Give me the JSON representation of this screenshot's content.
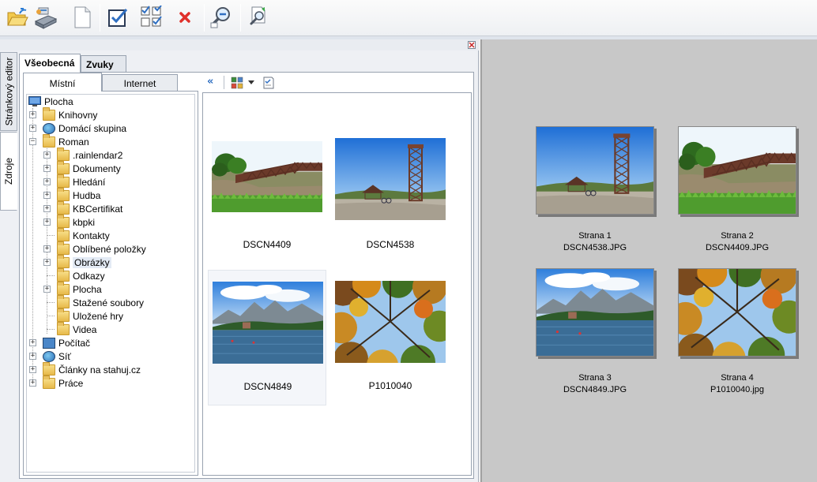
{
  "toolbar": {
    "buttons": [
      {
        "icon": "open-folder-icon"
      },
      {
        "icon": "scanner-icon"
      },
      {
        "icon": "blank-page-icon"
      },
      {
        "icon": "check-all-icon"
      },
      {
        "icon": "select-grid-icon"
      },
      {
        "icon": "delete-icon"
      },
      {
        "icon": "zoom-out-icon"
      },
      {
        "icon": "print-preview-icon"
      }
    ]
  },
  "side_tabs": [
    "Stránkový editor",
    "Zdroje"
  ],
  "main_tabs": [
    "Všeobecná",
    "Zvuky"
  ],
  "sub_tabs": [
    "Místní",
    "Internet"
  ],
  "tree": {
    "root": "Plocha",
    "items": [
      {
        "label": "Knihovny",
        "level": 1,
        "expander": "+"
      },
      {
        "label": "Domácí skupina",
        "level": 1,
        "expander": "+"
      },
      {
        "label": "Roman",
        "level": 1,
        "expander": "−"
      },
      {
        "label": ".rainlendar2",
        "level": 2,
        "expander": "+"
      },
      {
        "label": "Dokumenty",
        "level": 2,
        "expander": "+"
      },
      {
        "label": "Hledání",
        "level": 2,
        "expander": "+"
      },
      {
        "label": "Hudba",
        "level": 2,
        "expander": "+"
      },
      {
        "label": "KBCertifikat",
        "level": 2,
        "expander": "+"
      },
      {
        "label": "kbpki",
        "level": 2,
        "expander": "+"
      },
      {
        "label": "Kontakty",
        "level": 2,
        "expander": ""
      },
      {
        "label": "Oblíbené položky",
        "level": 2,
        "expander": "+"
      },
      {
        "label": "Obrázky",
        "level": 2,
        "expander": "+",
        "selected": true
      },
      {
        "label": "Odkazy",
        "level": 2,
        "expander": ""
      },
      {
        "label": "Plocha",
        "level": 2,
        "expander": "+"
      },
      {
        "label": "Stažené soubory",
        "level": 2,
        "expander": ""
      },
      {
        "label": "Uložené hry",
        "level": 2,
        "expander": ""
      },
      {
        "label": "Videa",
        "level": 2,
        "expander": ""
      },
      {
        "label": "Počítač",
        "level": 1,
        "expander": "+"
      },
      {
        "label": "Síť",
        "level": 1,
        "expander": "+"
      },
      {
        "label": "Články na stahuj.cz",
        "level": 1,
        "expander": "+"
      },
      {
        "label": "Práce",
        "level": 1,
        "expander": "+"
      }
    ]
  },
  "browser": {
    "thumbnails": [
      {
        "name": "DSCN4409",
        "scene": "bridge"
      },
      {
        "name": "DSCN4538",
        "scene": "tower"
      },
      {
        "name": "DSCN4849",
        "scene": "lake",
        "selected": true
      },
      {
        "name": "P1010040",
        "scene": "trees"
      }
    ]
  },
  "preview": {
    "pages": [
      {
        "title": "Strana 1",
        "file": "DSCN4538.JPG",
        "scene": "tower"
      },
      {
        "title": "Strana 2",
        "file": "DSCN4409.JPG",
        "scene": "bridge"
      },
      {
        "title": "Strana 3",
        "file": "DSCN4849.JPG",
        "scene": "lake"
      },
      {
        "title": "Strana 4",
        "file": "P1010040.jpg",
        "scene": "trees"
      }
    ]
  },
  "colors": {
    "preview_bg": "#c8c8c8",
    "delete_red": "#e0302a",
    "accent_blue": "#2f6fc2"
  }
}
